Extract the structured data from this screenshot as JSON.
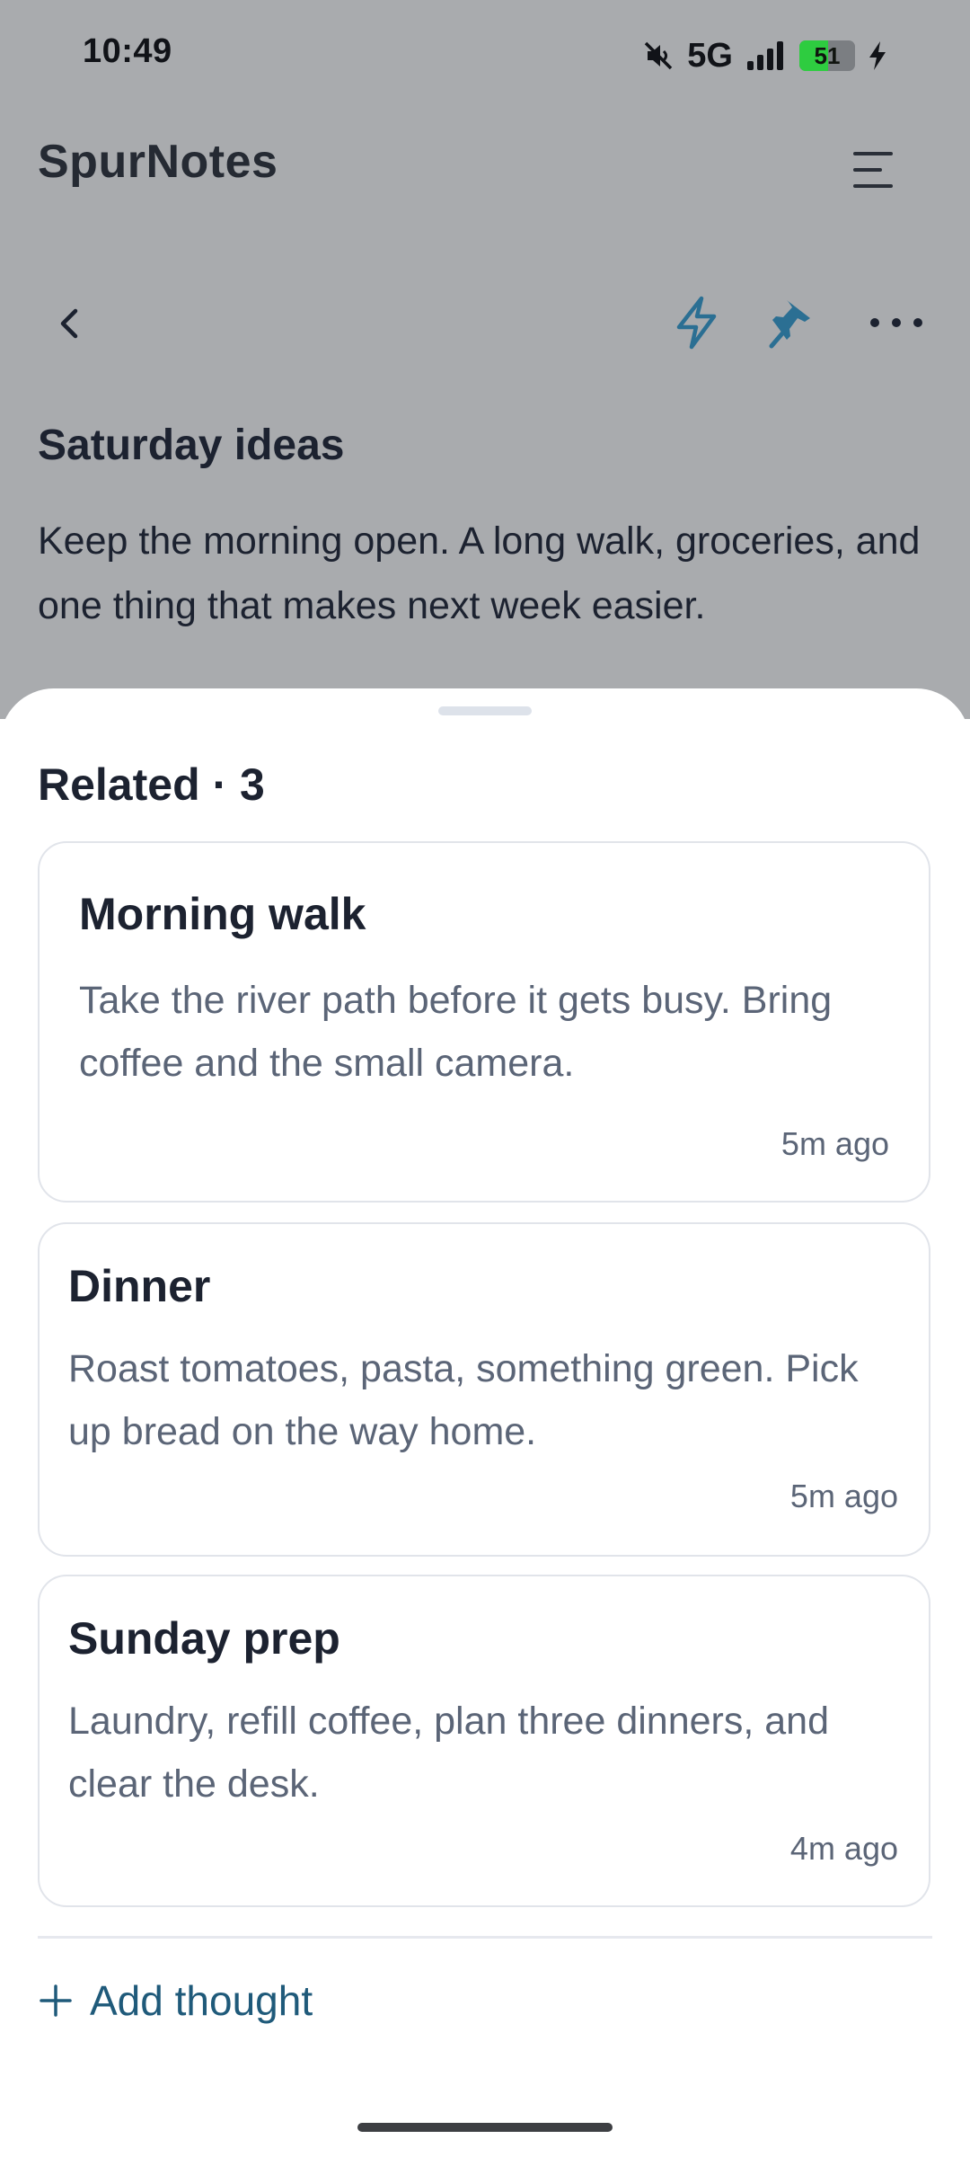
{
  "status_bar": {
    "time": "10:49",
    "network": "5G",
    "battery_level": "51",
    "battery_percent": 51,
    "icons": [
      "mute-icon",
      "signal-icon",
      "battery-icon",
      "charging-icon"
    ]
  },
  "app": {
    "title": "SpurNotes",
    "menu_icon": "menu-icon"
  },
  "toolbar": {
    "icons": [
      "back-icon",
      "bolt-icon",
      "pin-icon",
      "more-icon"
    ]
  },
  "note": {
    "title": "Saturday ideas",
    "body": "Keep the morning open. A long walk, groceries, and one thing that makes next week easier."
  },
  "sheet": {
    "heading": "Related · 3",
    "cards": [
      {
        "title": "Morning walk",
        "body": "Take the river path before it gets busy. Bring coffee and the small camera.",
        "time": "5m ago"
      },
      {
        "title": "Dinner",
        "body": "Roast tomatoes, pasta, something green. Pick up bread on the way home.",
        "time": "5m ago"
      },
      {
        "title": "Sunday prep",
        "body": "Laundry, refill coffee, plan three dinners, and clear the desk.",
        "time": "4m ago"
      }
    ],
    "add_label": "Add thought"
  },
  "colors": {
    "dim_background": "#a9abae",
    "accent_blue": "#1f5a7a",
    "icon_blue": "#2b6f93",
    "battery_green": "#2ecc40",
    "text_dark": "#1c2230",
    "text_muted": "#5b6577"
  }
}
